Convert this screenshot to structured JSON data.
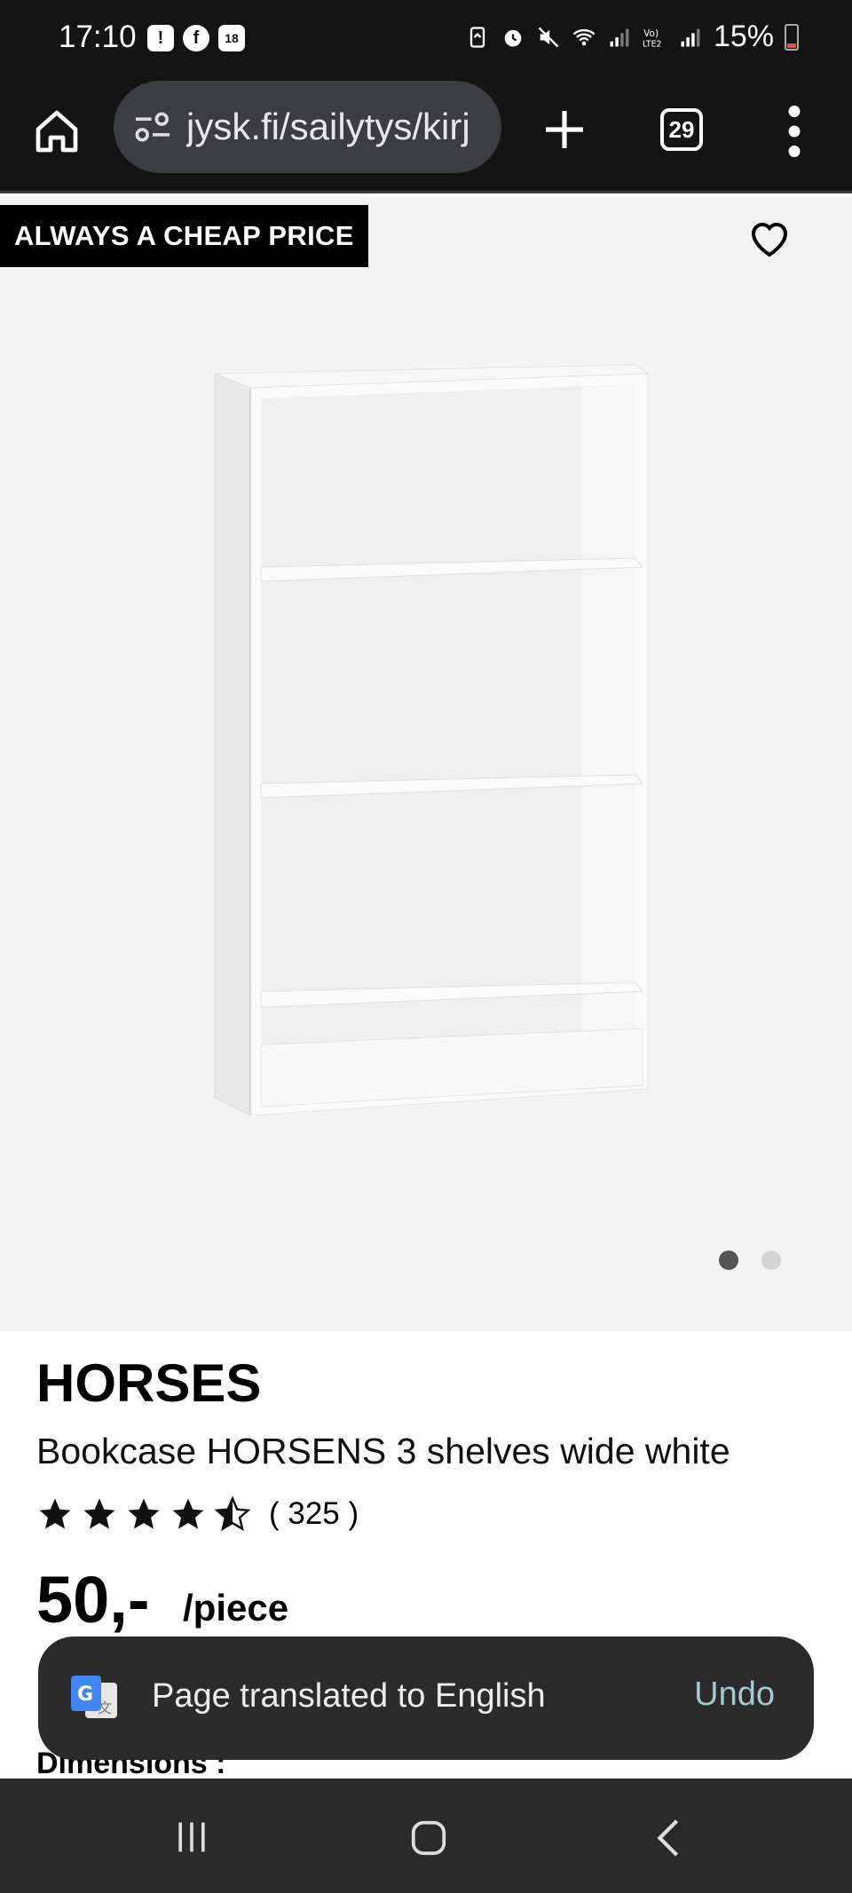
{
  "status_bar": {
    "time": "17:10",
    "left_icons": [
      "!",
      "f",
      "18"
    ],
    "right_icons": [
      "battery-saver-icon",
      "alarm-icon",
      "mute-icon",
      "wifi-icon",
      "signal-icon",
      "volte-icon",
      "signal-2-icon"
    ],
    "battery_percent": "15%"
  },
  "browser": {
    "url": "jysk.fi/sailytys/kirj",
    "tab_count": "29"
  },
  "product": {
    "badge": "ALWAYS A CHEAP PRICE",
    "brand": "HORSES",
    "name": "Bookcase HORSENS 3 shelves wide white",
    "rating": 4.5,
    "review_count": "( 325 )",
    "price": "50,-",
    "unit": "/piece",
    "dimensions_label": "Dimensions :",
    "image_count": 2,
    "active_image": 1
  },
  "toast": {
    "message": "Page translated to English",
    "action": "Undo"
  },
  "colors": {
    "status_bg": "#141414",
    "image_bg": "#f3f3f3",
    "toast_bg": "#2b2b2b",
    "undo": "#a9c7d1",
    "nav_bg": "#2a2a2a"
  }
}
